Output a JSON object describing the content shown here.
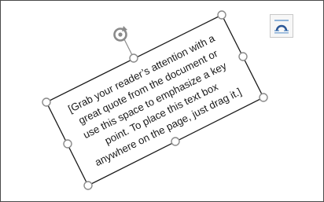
{
  "text_box": {
    "lines": [
      "[Grab your reader’s attention with a",
      "great quote from the document or",
      "use this space to emphasize a key",
      "point. To place this text box",
      "anywhere on the page, just drag it.]"
    ]
  },
  "icons": {
    "rotate": "rotate-handle-icon",
    "layout_options": "layout-options-icon"
  },
  "colors": {
    "border": "#1a1a1a",
    "handle": "#8a8a8a",
    "layout_icon_accent": "#2b5797",
    "layout_icon_wrap": "#8fb3d9"
  }
}
